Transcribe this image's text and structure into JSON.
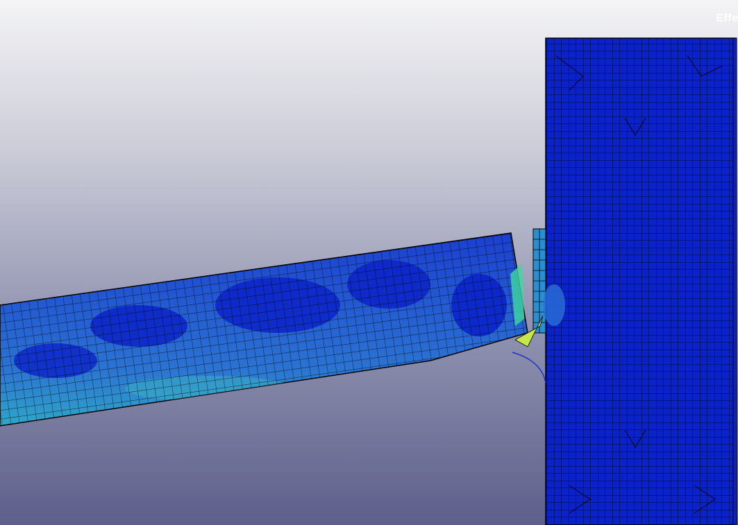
{
  "viewport": {
    "legend_title": "Effec",
    "background_top": "#f4f4f6",
    "background_bottom": "#5c5f8a"
  },
  "mesh": {
    "workpiece_color": "#0a23c8",
    "tool_color": "#2a6fd0",
    "high_stress_color": "#3fd9a0",
    "peak_color": "#c8e64a",
    "line_color": "#000000"
  }
}
